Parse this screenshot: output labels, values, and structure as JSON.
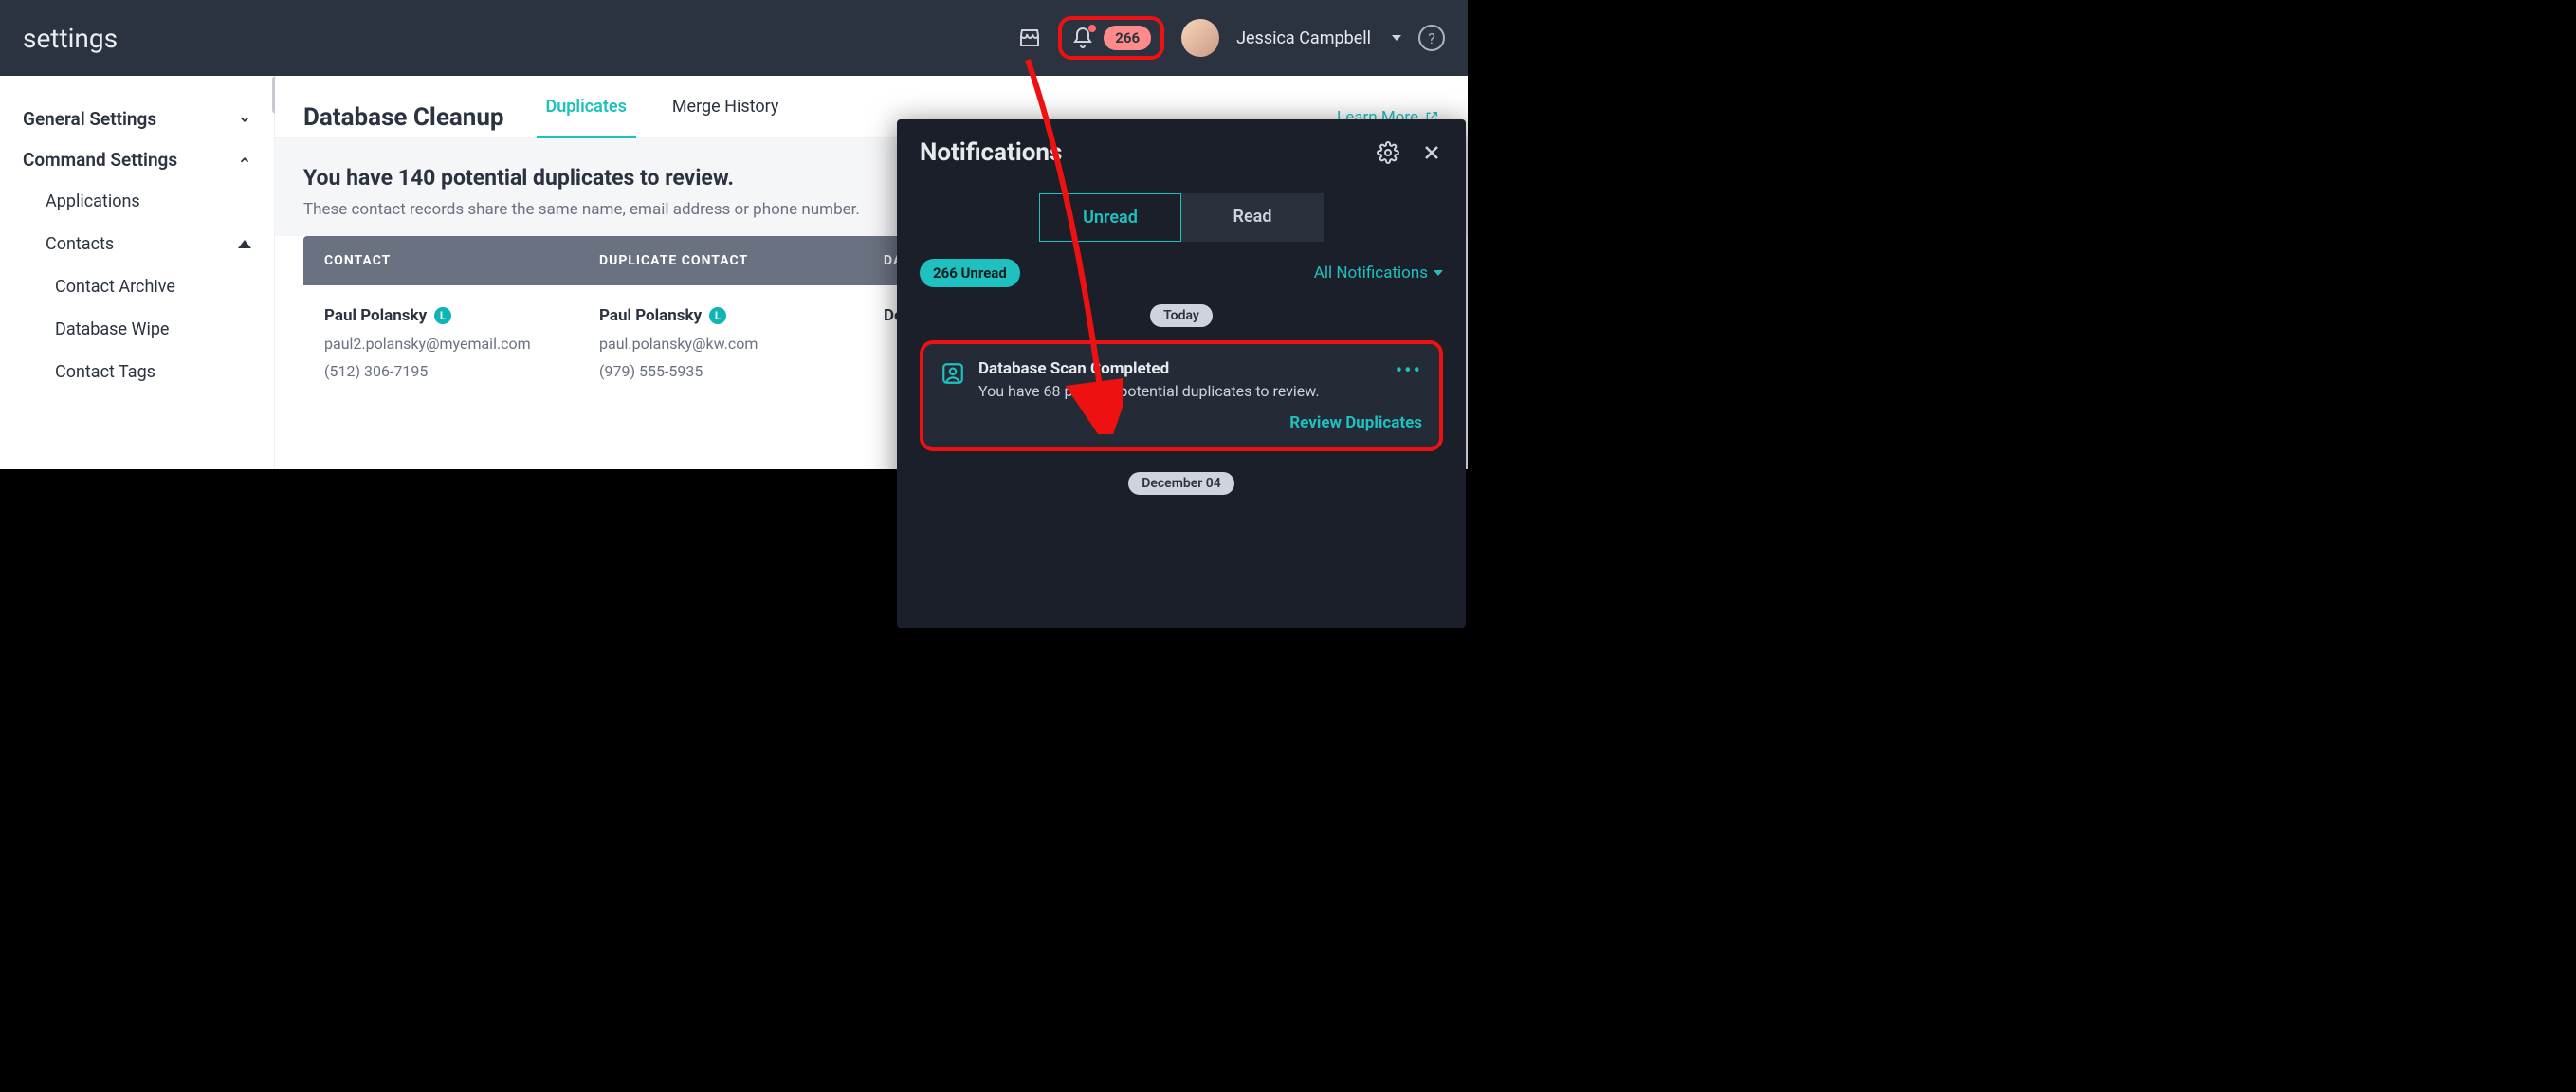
{
  "header": {
    "title": "settings",
    "badge_count": "266",
    "user_name": "Jessica Campbell"
  },
  "sidebar": {
    "group1": "General Settings",
    "group2": "Command Settings",
    "items": {
      "applications": "Applications",
      "contacts": "Contacts",
      "contact_archive": "Contact Archive",
      "database_wipe": "Database Wipe",
      "contact_tags": "Contact Tags"
    }
  },
  "content": {
    "page_title": "Database Cleanup",
    "tab_duplicates": "Duplicates",
    "tab_merge_history": "Merge History",
    "learn_more": "Learn More",
    "summary_title": "You have 140 potential duplicates to review.",
    "summary_sub": "These contact records share the same name, email address or phone number.",
    "th_contact": "CONTACT",
    "th_dup": "DUPLICATE CONTACT",
    "th_date": "DAT",
    "row1": {
      "name_a": "Paul Polansky",
      "email_a": "paul2.polansky@myemail.com",
      "phone_a": "(512) 306-7195",
      "name_b": "Paul Polansky",
      "email_b": "paul.polansky@kw.com",
      "phone_b": "(979) 555-5935",
      "date": "Dec"
    },
    "lbadge": "L"
  },
  "notifications": {
    "title": "Notifications",
    "tab_unread": "Unread",
    "tab_read": "Read",
    "pill": "266 Unread",
    "all": "All Notifications",
    "day_today": "Today",
    "day_dec4": "December 04",
    "card": {
      "title": "Database Scan Completed",
      "sub": "You have 68 pairs of potential duplicates to review.",
      "action": "Review Duplicates",
      "dots": "•••"
    }
  }
}
